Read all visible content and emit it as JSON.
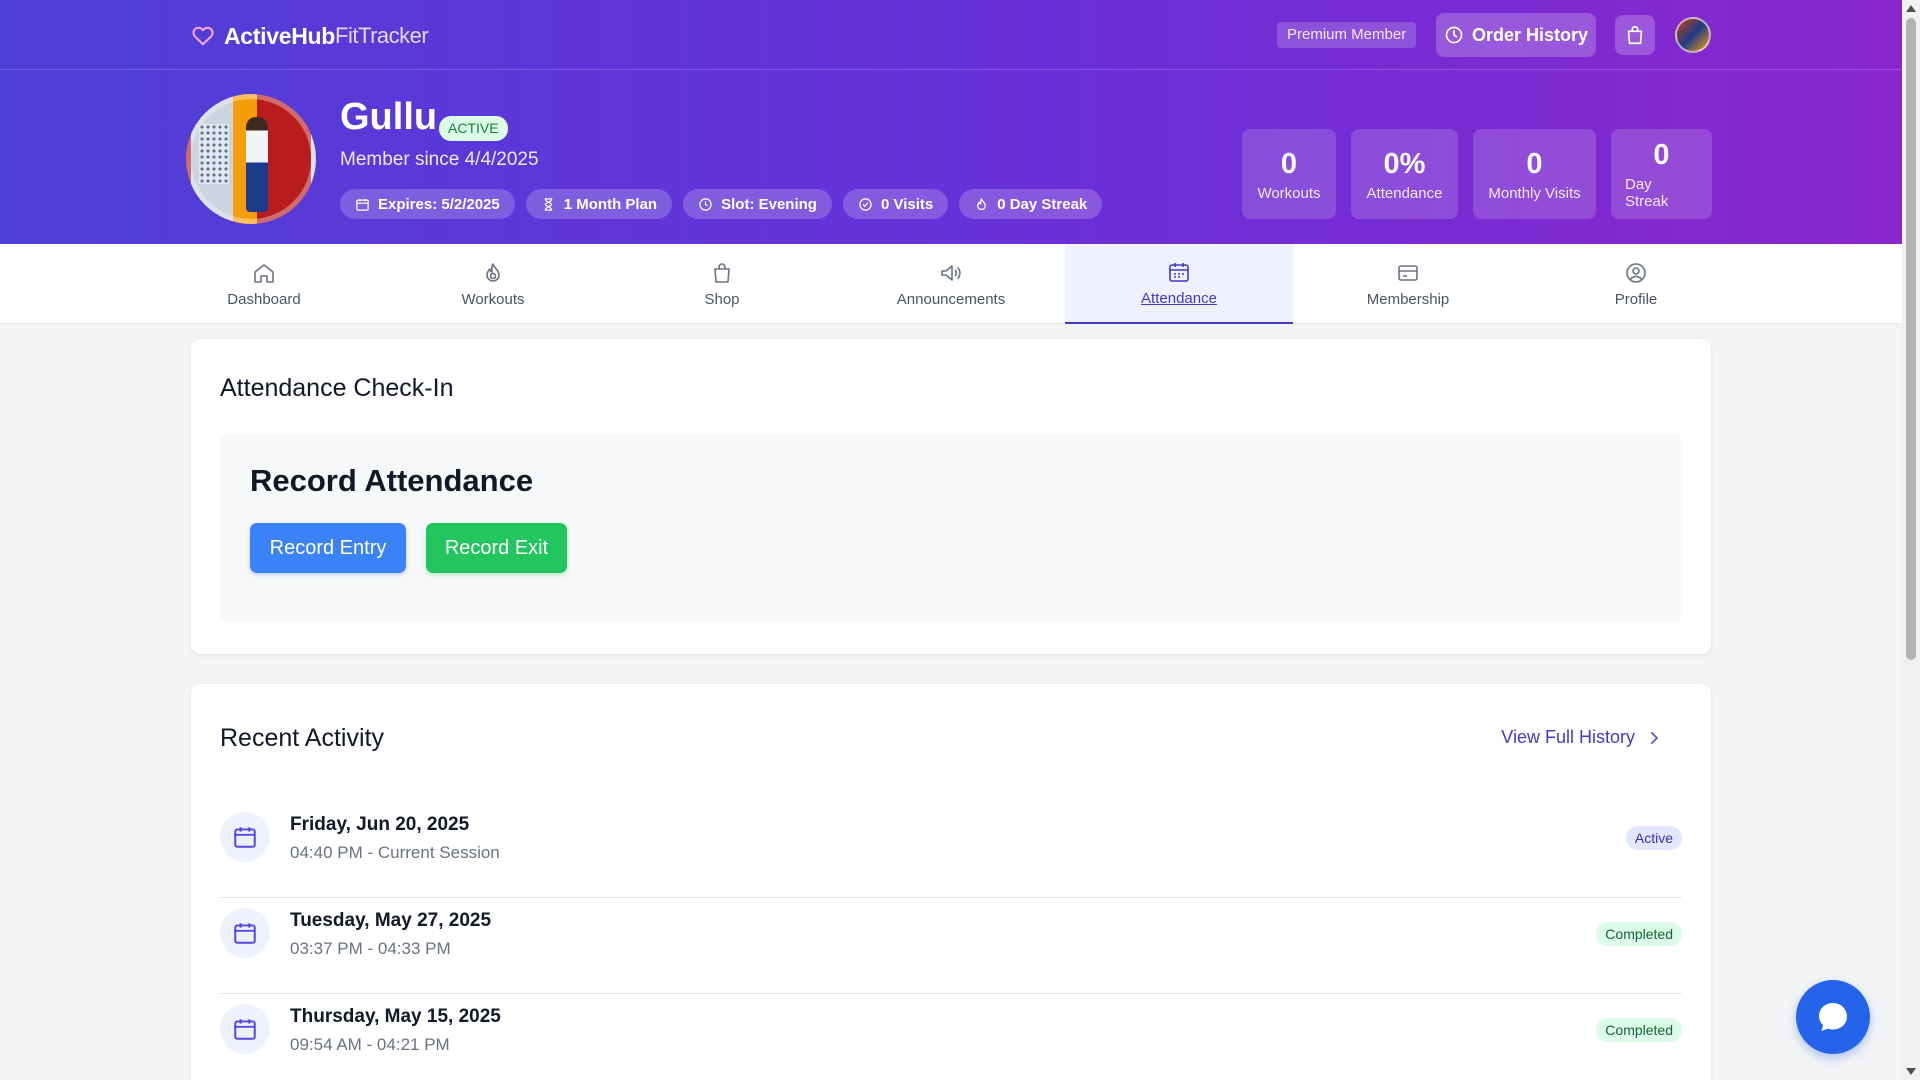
{
  "brand": {
    "name": "ActiveHub",
    "sub": "FitTracker"
  },
  "header": {
    "premium_label": "Premium Member",
    "order_history_label": "Order History"
  },
  "profile": {
    "name": "Gullu",
    "status": "ACTIVE",
    "member_since": "Member since 4/4/2025",
    "chips": [
      {
        "icon": "calendar-icon",
        "label": "Expires: 5/2/2025"
      },
      {
        "icon": "hourglass-icon",
        "label": "1 Month Plan"
      },
      {
        "icon": "clock-icon",
        "label": "Slot: Evening"
      },
      {
        "icon": "check-circle-icon",
        "label": "0 Visits"
      },
      {
        "icon": "flame-icon",
        "label": "0 Day Streak"
      }
    ],
    "stats": [
      {
        "value": "0",
        "label": "Workouts"
      },
      {
        "value": "0%",
        "label": "Attendance"
      },
      {
        "value": "0",
        "label": "Monthly Visits"
      },
      {
        "value": "0",
        "label": "Day Streak"
      }
    ]
  },
  "tabs": [
    {
      "label": "Dashboard",
      "icon": "home-icon"
    },
    {
      "label": "Workouts",
      "icon": "flame-icon"
    },
    {
      "label": "Shop",
      "icon": "bag-icon"
    },
    {
      "label": "Announcements",
      "icon": "megaphone-icon"
    },
    {
      "label": "Attendance",
      "icon": "calendar-icon",
      "active": true
    },
    {
      "label": "Membership",
      "icon": "card-icon"
    },
    {
      "label": "Profile",
      "icon": "user-circle-icon"
    }
  ],
  "checkin": {
    "title": "Attendance Check-In",
    "panel_title": "Record Attendance",
    "entry_label": "Record Entry",
    "exit_label": "Record Exit"
  },
  "activity": {
    "title": "Recent Activity",
    "view_history_label": "View Full History",
    "items": [
      {
        "date": "Friday, Jun 20, 2025",
        "time": "04:40 PM - Current Session",
        "status": "Active"
      },
      {
        "date": "Tuesday, May 27, 2025",
        "time": "03:37 PM - 04:33 PM",
        "status": "Completed"
      },
      {
        "date": "Thursday, May 15, 2025",
        "time": "09:54 AM - 04:21 PM",
        "status": "Completed"
      },
      {
        "date": "",
        "time": "",
        "status": ""
      }
    ]
  },
  "colors": {
    "gradient_start": "#4f3fd6",
    "gradient_end": "#8a27cc",
    "accent": "#4338ca",
    "entry_button": "#3b82f6",
    "exit_button": "#22c55e"
  }
}
